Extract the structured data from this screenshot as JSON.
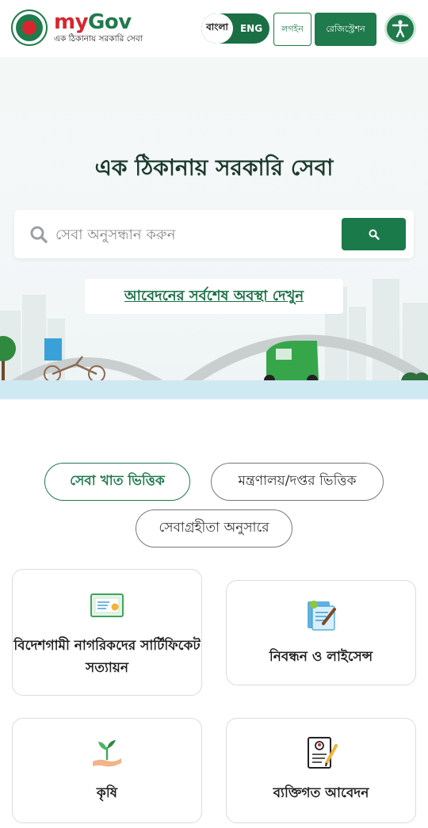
{
  "header": {
    "brand_my": "my",
    "brand_gov": "Gov",
    "tagline": "এক ঠিকানায় সরকারি সেবা",
    "lang_bn": "বাংলা",
    "lang_en": "ENG",
    "login_label": "লগইন",
    "register_label": "রেজিস্ট্রেশন"
  },
  "hero": {
    "title": "এক ঠিকানায় সরকারি সেবা",
    "search_placeholder": "সেবা অনুসন্ধান করুন",
    "status_link": "আবেদনের সর্বশেষ অবস্থা দেখুন"
  },
  "tabs": [
    {
      "label": "সেবা খাত ভিত্তিক",
      "active": true
    },
    {
      "label": "মন্ত্রণালয়/দপ্তর ভিত্তিক",
      "active": false
    },
    {
      "label": "সেবাগ্রহীতা অনুসারে",
      "active": false
    }
  ],
  "services": [
    {
      "label": "বিদেশগামী নাগরিকদের সার্টিফিকেট সত্যায়ন",
      "icon": "certificate-icon"
    },
    {
      "label": "নিবন্ধন ও লাইসেন্স",
      "icon": "registration-license-icon"
    },
    {
      "label": "কৃষি",
      "icon": "agriculture-plant-icon"
    },
    {
      "label": "ব্যক্তিগত আবেদন",
      "icon": "personal-application-icon"
    }
  ],
  "colors": {
    "primary": "#1f7a4c",
    "brand_red": "#d8262e",
    "title_text": "#1c3a2c"
  }
}
